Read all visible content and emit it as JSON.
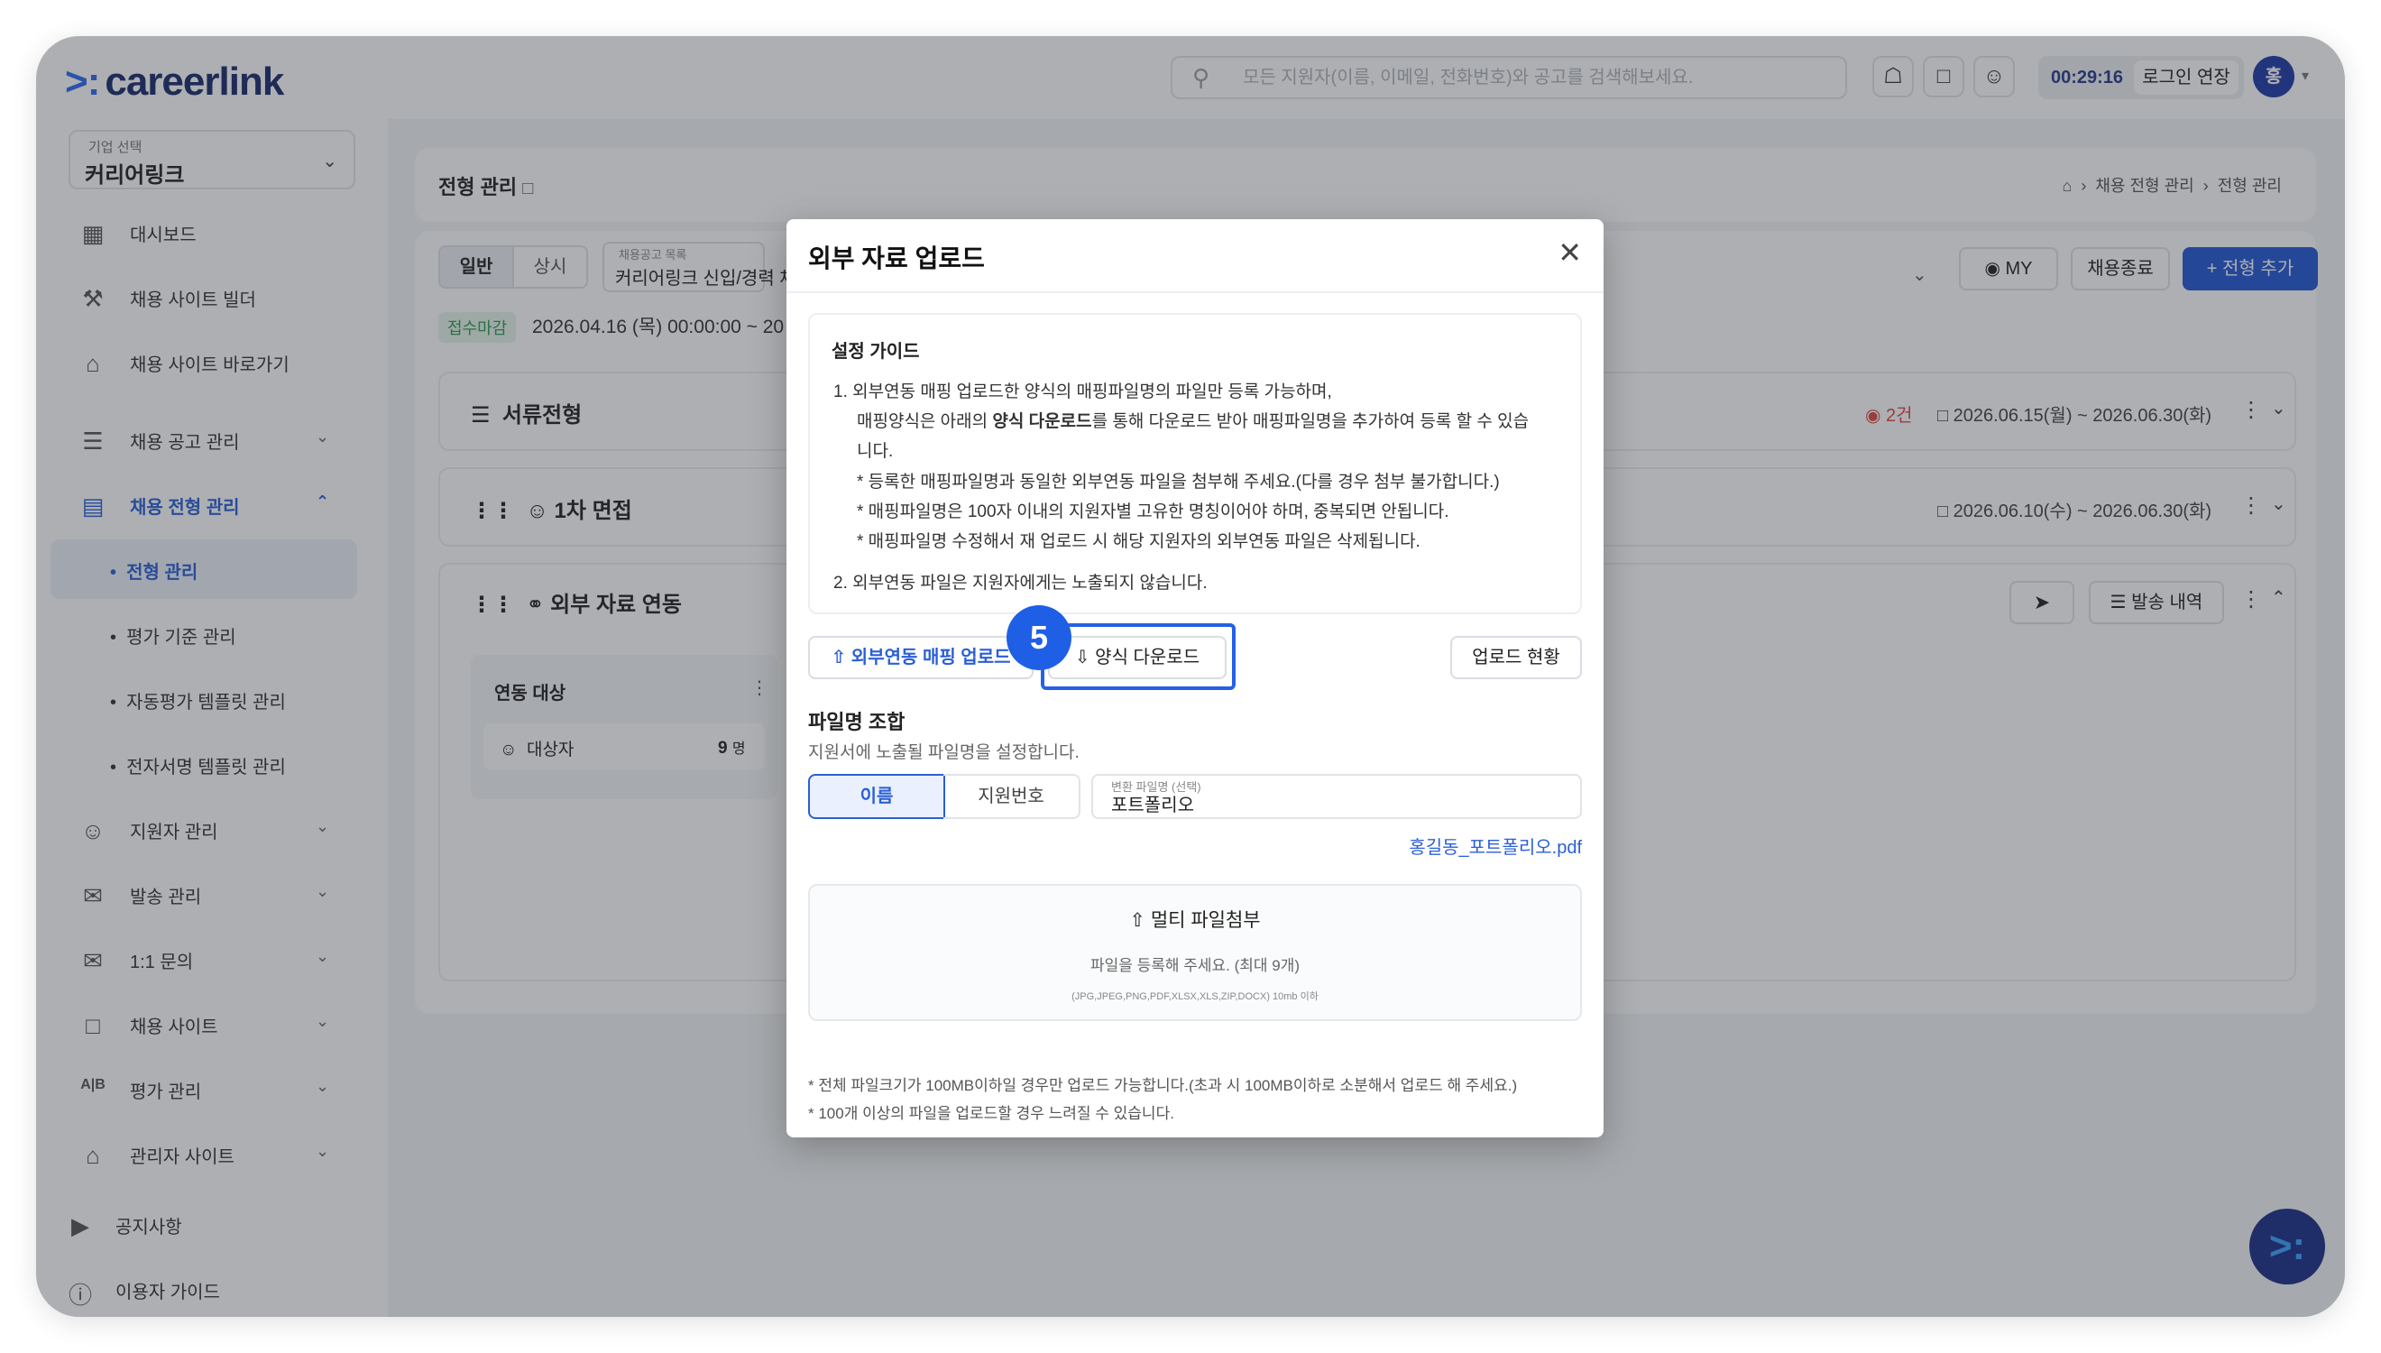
{
  "brand": "careerlink",
  "search": {
    "placeholder": "모든 지원자(이름, 이메일, 전화번호)와 공고를 검색해보세요."
  },
  "session": {
    "timer": "00:29:16",
    "extend": "로그인 연장",
    "avatar": "홍"
  },
  "company": {
    "label": "기업 선택",
    "value": "커리어링크"
  },
  "sidebar": {
    "items": [
      {
        "label": "대시보드",
        "icon": "chart-icon"
      },
      {
        "label": "채용 사이트 빌더",
        "icon": "tools-icon"
      },
      {
        "label": "채용 사이트 바로가기",
        "icon": "home-icon"
      },
      {
        "label": "채용 공고 관리",
        "icon": "list-icon"
      },
      {
        "label": "채용 전형 관리",
        "icon": "clipboard-icon"
      },
      {
        "label": "지원자 관리",
        "icon": "users-icon"
      },
      {
        "label": "발송 관리",
        "icon": "mail-icon"
      },
      {
        "label": "1:1 문의",
        "icon": "chat-icon"
      },
      {
        "label": "채용 사이트",
        "icon": "calendar-icon"
      },
      {
        "label": "평가 관리",
        "icon": "ab-icon"
      },
      {
        "label": "관리자 사이트",
        "icon": "admin-icon"
      },
      {
        "label": "공지사항",
        "icon": "megaphone-icon"
      },
      {
        "label": "이용자 가이드",
        "icon": "help-icon"
      }
    ],
    "sub": [
      "전형 관리",
      "평가 기준 관리",
      "자동평가 템플릿 관리",
      "전자서명 템플릿 관리"
    ]
  },
  "page": {
    "title": "전형 관리",
    "breadcrumb": [
      "채용 전형 관리",
      "전형 관리"
    ],
    "seg": [
      "일반",
      "상시"
    ],
    "posting_label": "채용공고 목록",
    "posting_value": "커리어링크 신입/경력 채",
    "status": "접수마감",
    "period": "2026.04.16 (목) 00:00:00 ~ 20",
    "my": "MY",
    "close": "채용종료",
    "add": "전형 추가",
    "stages": [
      {
        "name": "서류전형",
        "count": "2건",
        "date": "2026.06.15(월) ~ 2026.06.30(화)"
      },
      {
        "name": "1차 면접",
        "date": "2026.06.10(수) ~ 2026.06.30(화)"
      },
      {
        "name": "외부 자료 연동",
        "send": "발송 내역"
      }
    ],
    "link_target": {
      "title": "연동 대상",
      "label": "대상자",
      "count": "9",
      "unit": "명"
    }
  },
  "modal": {
    "title": "외부 자료 업로드",
    "guide_title": "설정 가이드",
    "guide": [
      "1.  외부연동 매핑 업로드한 양식의 매핑파일명의 파일만 등록 가능하며,",
      "매핑양식은 아래의 ",
      "양식 다운로드",
      "를 통해 다운로드 받아 매핑파일명을 추가하여 등록 할 수 있습",
      "니다.",
      "* 등록한 매핑파일명과 동일한 외부연동 파일을 첨부해 주세요.(다를 경우 첨부 불가합니다.)",
      "* 매핑파일명은 100자 이내의 지원자별 고유한 명칭이어야 하며, 중복되면 안됩니다.",
      "* 매핑파일명 수정해서 재 업로드 시 해당 지원자의 외부연동 파일은 삭제됩니다.",
      "2.  외부연동 파일은 지원자에게는 노출되지 않습니다."
    ],
    "btn_mapping": "외부연동 매핑 업로드",
    "btn_download": "양식 다운로드",
    "btn_status": "업로드 현황",
    "step": "5",
    "filename_title": "파일명 조합",
    "filename_desc": "지원서에 노출될 파일명을 설정합니다.",
    "chip_name": "이름",
    "chip_number": "지원번호",
    "convert_label": "변환 파일명 (선택)",
    "convert_value": "포트폴리오",
    "preview": "홍길동_포트폴리오.pdf",
    "drop_title": "멀티 파일첨부",
    "drop_desc": "파일을 등록해 주세요. (최대 9개)",
    "drop_formats": "(JPG,JPEG,PNG,PDF,XLSX,XLS,ZIP,DOCX) 10mb 이하",
    "note1": "* 전체 파일크기가 100MB이하일 경우만 업로드 가능합니다.(초과 시 100MB이하로 소분해서 업로드 해 주세요.)",
    "note2": "* 100개 이상의 파일을 업로드할 경우 느려질 수 있습니다."
  }
}
